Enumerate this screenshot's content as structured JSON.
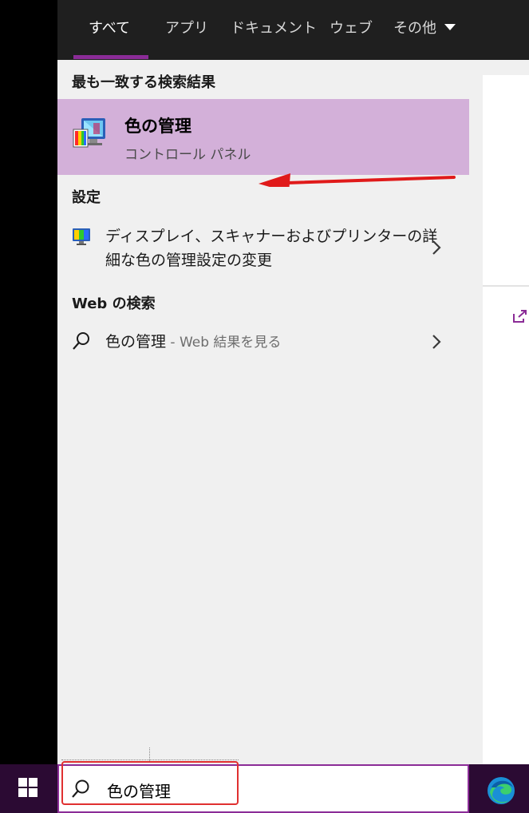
{
  "tabs": [
    {
      "label": "すべて",
      "active": true
    },
    {
      "label": "アプリ",
      "active": false
    },
    {
      "label": "ドキュメント",
      "active": false
    },
    {
      "label": "ウェブ",
      "active": false
    },
    {
      "label": "その他",
      "active": false
    }
  ],
  "best_match": {
    "header": "最も一致する検索結果",
    "title": "色の管理",
    "subtitle": "コントロール パネル",
    "icon": "color-management-icon"
  },
  "settings": {
    "header": "設定",
    "item": {
      "line1": "ディスプレイ、スキャナーおよびプリンターの詳",
      "line2": "細な色の管理設定の変更",
      "icon": "monitor-settings-icon"
    }
  },
  "web": {
    "header": "Web の検索",
    "query": "色の管理",
    "suffix": " - Web 結果を見る",
    "icon": "search-icon"
  },
  "search_box": {
    "value": "色の管理",
    "icon": "search-icon"
  },
  "taskbar": {
    "start_icon": "windows-start-icon",
    "edge_icon": "edge-browser-icon"
  },
  "colors": {
    "accent": "#8b2c97",
    "highlight": "#d3b0d9",
    "annotation_red": "#e03030"
  }
}
